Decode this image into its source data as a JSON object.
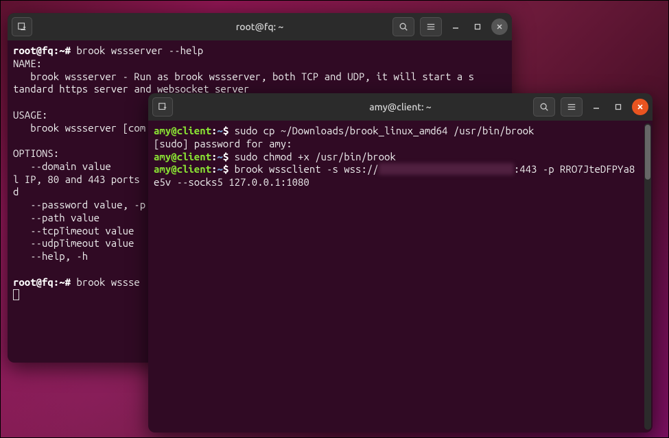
{
  "window_back": {
    "title": "root@fq: ~",
    "prompt1": "root@fq:~# ",
    "cmd1": "brook wssserver --help",
    "out1": "NAME:\n   brook wssserver - Run as brook wssserver, both TCP and UDP, it will start a s\ntandard https server and websocket server\n\nUSAGE:\n   brook wssserver [com",
    "out2": "\nOPTIONS:\n   --domain value\nl IP, 80 and 443 ports\nd\n   --password value, -p\n   --path value\n   --tcpTimeout value\n   --udpTimeout value\n   --help, -h\n",
    "prompt2": "root@fq:~# ",
    "cmd2": "brook wssse"
  },
  "window_front": {
    "title": "amy@client: ~",
    "user": "amy@client",
    "path": "~",
    "cmd1": "sudo cp ~/Downloads/brook_linux_amd64 /usr/bin/brook",
    "line2": "[sudo] password for amy:",
    "cmd2": "sudo chmod +x /usr/bin/brook",
    "cmd3a": "brook wssclient -s wss://",
    "cmd3_hidden": "xxxxxxxxxxxxxxxxxxxxxxx",
    "cmd3b": ":443 -p RRO7JteDFPYa8",
    "cmd3c": "e5v --socks5 127.0.0.1:1080"
  },
  "icons": {
    "newtab": "new-tab-icon",
    "search": "search-icon",
    "menu": "menu-icon",
    "minimize": "minimize-icon",
    "maximize": "maximize-icon",
    "close": "close-icon"
  }
}
